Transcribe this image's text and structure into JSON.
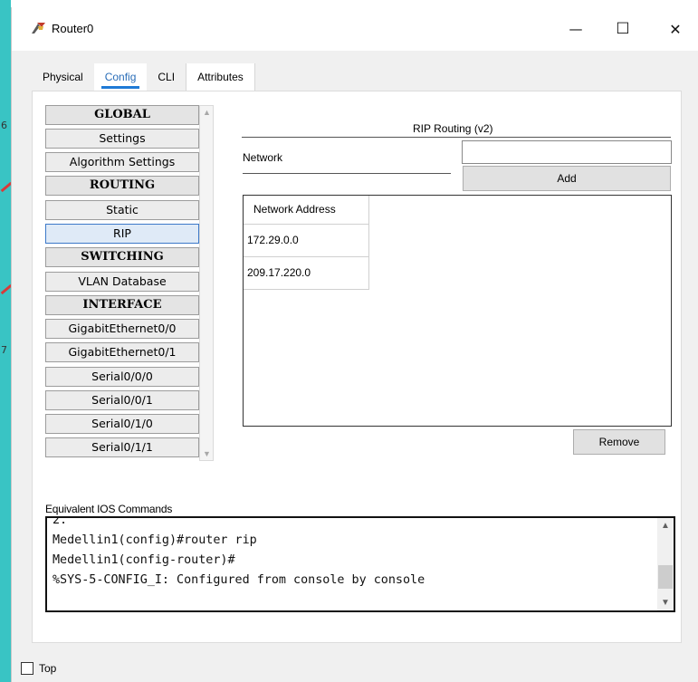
{
  "window": {
    "title": "Router0",
    "controls": {
      "minimize": "—",
      "maximize": "☐",
      "close": "✕"
    }
  },
  "tabs": [
    {
      "label": "Physical",
      "active": false
    },
    {
      "label": "Config",
      "active": true
    },
    {
      "label": "CLI",
      "active": false
    },
    {
      "label": "Attributes",
      "active": false
    }
  ],
  "sidebar": {
    "items": [
      {
        "label": "GLOBAL",
        "type": "header"
      },
      {
        "label": "Settings",
        "type": "item"
      },
      {
        "label": "Algorithm Settings",
        "type": "item"
      },
      {
        "label": "ROUTING",
        "type": "header"
      },
      {
        "label": "Static",
        "type": "item"
      },
      {
        "label": "RIP",
        "type": "item",
        "selected": true
      },
      {
        "label": "SWITCHING",
        "type": "header"
      },
      {
        "label": "VLAN Database",
        "type": "item"
      },
      {
        "label": "INTERFACE",
        "type": "header"
      },
      {
        "label": "GigabitEthernet0/0",
        "type": "item"
      },
      {
        "label": "GigabitEthernet0/1",
        "type": "item"
      },
      {
        "label": "Serial0/0/0",
        "type": "item"
      },
      {
        "label": "Serial0/0/1",
        "type": "item"
      },
      {
        "label": "Serial0/1/0",
        "type": "item"
      },
      {
        "label": "Serial0/1/1",
        "type": "item"
      }
    ]
  },
  "rip": {
    "title": "RIP Routing (v2)",
    "network_label": "Network",
    "network_value": "",
    "add_label": "Add",
    "table_header": "Network Address",
    "networks": [
      "172.29.0.0",
      "209.17.220.0"
    ],
    "remove_label": "Remove"
  },
  "ios": {
    "label": "Equivalent IOS Commands",
    "lines": [
      "2.",
      "Medellin1(config)#router rip",
      "Medellin1(config-router)#",
      "%SYS-5-CONFIG_I: Configured from console by console"
    ]
  },
  "footer": {
    "top_label": "Top",
    "top_checked": false
  },
  "background": {
    "digits": [
      "6",
      "7"
    ]
  },
  "colors": {
    "accent": "#1f7ad6",
    "selected_bg": "#dfeaf7",
    "window_bg": "#f0f0f0"
  }
}
